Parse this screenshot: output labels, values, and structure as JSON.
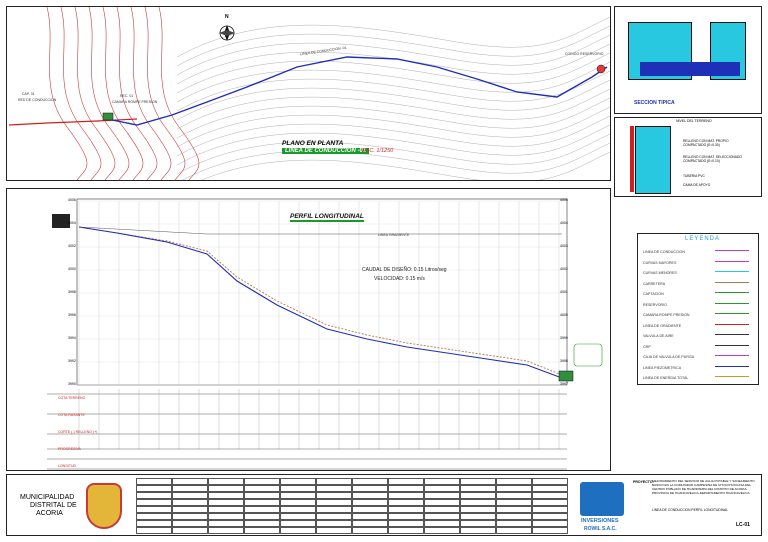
{
  "colors": {
    "frame": "#222222",
    "contour_red": "#c83a3a",
    "contour_gray": "#9a9a9a",
    "pipe_blue": "#1e2fb8",
    "terrain_brown": "#b9784a",
    "heading_green": "#1a9a2a",
    "water_cyan": "#27c8e0",
    "legend_magenta": "#c03cc0",
    "label_red": "#d02020",
    "profile_green": "#2a9a2a"
  },
  "plan": {
    "title": "PLANO EN PLANTA",
    "subtitle": "LINEA DE CONDUCCION -01",
    "scale": "ESC. 1/1250",
    "north": "N",
    "line_label": "LINEA DE CONDUCCION -01",
    "start_label_1": "CAP. 01",
    "start_label_2": "RED DE CONDUCCION",
    "station_label_1": "REC. 01",
    "station_label_2": "CAMARA ROMPE PRESION",
    "end_label": "CODIGO RESERVORIO"
  },
  "profile": {
    "title": "PERFIL LONGITUDINAL",
    "flow_label_1": "CAUDAL DE DISEÑO: 0.15 Litros/seg",
    "flow_label_2": "VELOCIDAD: 0.15 m/s",
    "gradient_label": "LINEA GRADIENTE",
    "y_ticks_left": [
      "4006",
      "4004",
      "4002",
      "4000",
      "3998",
      "3996",
      "3994",
      "3992",
      "3990"
    ],
    "y_ticks_right": [
      "4005",
      "4004",
      "4003",
      "4002",
      "4001",
      "4000",
      "3999",
      "3998",
      "3997"
    ],
    "table_rows": [
      "COTA TERRENO",
      "COTA RASANTE",
      "CORTE (-) RELLENO (+)",
      "PROGRESIVA",
      "LONGITUD"
    ]
  },
  "section": {
    "top_label": "SECCION TIPICA",
    "bottom_label": "NIVEL DEL TERRENO",
    "layer_1": "RELLENO CON MAT. PROPIO COMPACTADO (E=0.30)",
    "layer_2": "RELLENO CON MAT. SELECCIONADO COMPACTADO (E=0.10)",
    "layer_3": "TUBERIA PVC",
    "layer_4": "CAMA DE APOYO"
  },
  "legend": {
    "title": "LEYENDA",
    "items": [
      "LINEA DE CONDUCCION",
      "CURVAS MAYORES",
      "CURVAS MENORES",
      "CARRETERA",
      "CAPTACION",
      "RESERVORIO",
      "CAMARA ROMPE PRESION",
      "LINEA DE GRADIENTE",
      "VALVULA DE AIRE",
      "CRP",
      "CAJA DE VALVULA DE PURGA",
      "LINEA PIEZOMETRICA",
      "LINEA DE ENERGIA TOTAL"
    ]
  },
  "title_block": {
    "org_line_1": "MUNICIPALIDAD",
    "org_line_2": "DISTRITAL DE",
    "org_line_3": "ACORIA",
    "project_label": "PROYECTO:",
    "project_text": "MEJORAMIENTO DEL SERVICIO DE AGUA POTABLE Y SANEAMIENTO BASICO EN LA COMUNIDAD CAMPESINA DE CHUCCHUCCASA DEL CENTRO POBLADO DE HUARIPAMPA DEL DISTRITO DE ACORIA-PROVINCIA DE HUANCAVELICA-DEPARTAMENTO HUANCAVELICA",
    "plan_text": "LINEA DE CONDUCCION PERFIL LONGITUDINAL",
    "company": "INVERSIONES",
    "company_2": "ROWIL S.A.C.",
    "sheet": "LC-01"
  }
}
